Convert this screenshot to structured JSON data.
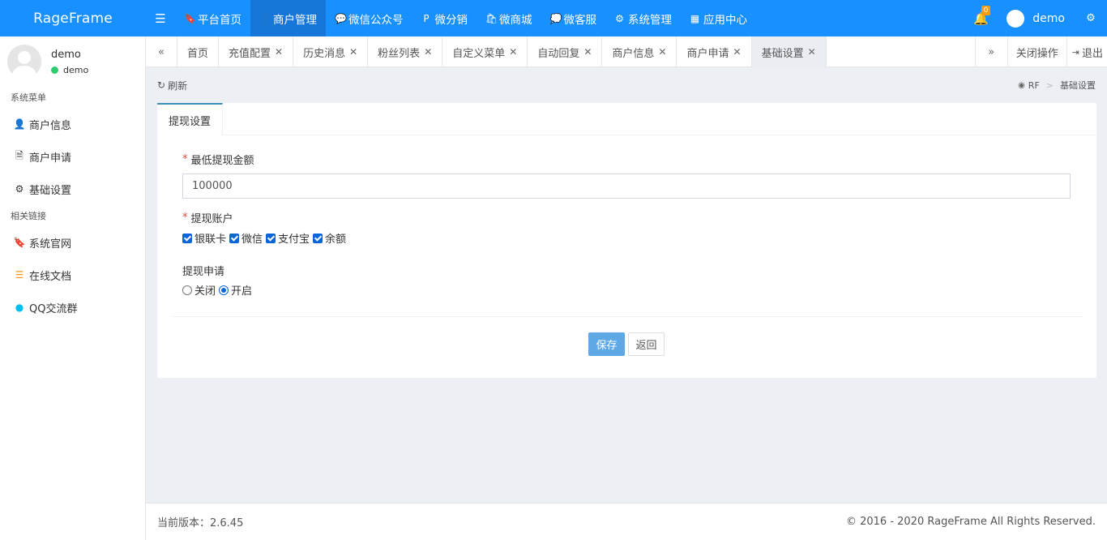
{
  "header": {
    "brand": "RageFrame",
    "nav": [
      {
        "label": "平台首页",
        "icon": "bookmark-icon",
        "glyph": "🔖",
        "active": false
      },
      {
        "label": "商户管理",
        "icon": "user-plus-icon",
        "glyph": "👤",
        "active": true
      },
      {
        "label": "微信公众号",
        "icon": "wechat-icon",
        "glyph": "💬",
        "active": false
      },
      {
        "label": "微分销",
        "icon": "product-hunt-icon",
        "glyph": "P",
        "active": false
      },
      {
        "label": "微商城",
        "icon": "shopping-bag-icon",
        "glyph": "🛍",
        "active": false
      },
      {
        "label": "微客服",
        "icon": "comments-icon",
        "glyph": "💭",
        "active": false
      },
      {
        "label": "系统管理",
        "icon": "cogs-icon",
        "glyph": "⚙",
        "active": false
      },
      {
        "label": "应用中心",
        "icon": "th-large-icon",
        "glyph": "▦",
        "active": false
      }
    ],
    "notification_count": "0",
    "username": "demo"
  },
  "sidebar": {
    "user_name": "demo",
    "user_status": "demo",
    "section1": "系统菜单",
    "items1": [
      {
        "label": "商户信息",
        "icon": "user-plus-icon",
        "glyph": "👤"
      },
      {
        "label": "商户申请",
        "icon": "file-text-icon",
        "glyph": "🗎"
      },
      {
        "label": "基础设置",
        "icon": "gear-icon",
        "glyph": "⚙"
      }
    ],
    "section2": "相关链接",
    "items2": [
      {
        "label": "系统官网",
        "icon": "bookmark-icon",
        "glyph": "🔖",
        "color": "#dd4b39"
      },
      {
        "label": "在线文档",
        "icon": "list-icon",
        "glyph": "☰",
        "color": "#f39c12"
      },
      {
        "label": "QQ交流群",
        "icon": "qq-icon",
        "glyph": "●",
        "color": "#00c0ef"
      }
    ]
  },
  "tabs": {
    "items": [
      {
        "label": "首页",
        "closable": false,
        "active": false
      },
      {
        "label": "充值配置",
        "closable": true,
        "active": false
      },
      {
        "label": "历史消息",
        "closable": true,
        "active": false
      },
      {
        "label": "粉丝列表",
        "closable": true,
        "active": false
      },
      {
        "label": "自定义菜单",
        "closable": true,
        "active": false
      },
      {
        "label": "自动回复",
        "closable": true,
        "active": false
      },
      {
        "label": "商户信息",
        "closable": true,
        "active": false
      },
      {
        "label": "商户申请",
        "closable": true,
        "active": false
      },
      {
        "label": "基础设置",
        "closable": true,
        "active": true
      }
    ],
    "close_ops": "关闭操作",
    "logout": "退出"
  },
  "content": {
    "refresh": "刷新",
    "breadcrumb_root": "RF",
    "breadcrumb_current": "基础设置",
    "box_tab": "提现设置",
    "min_amount_label": "最低提现金额",
    "min_amount_value": "100000",
    "accounts_label": "提现账户",
    "accounts": [
      {
        "label": "银联卡",
        "checked": true
      },
      {
        "label": "微信",
        "checked": true
      },
      {
        "label": "支付宝",
        "checked": true
      },
      {
        "label": "余额",
        "checked": true
      }
    ],
    "apply_label": "提现申请",
    "apply_options": [
      {
        "label": "关闭",
        "checked": false
      },
      {
        "label": "开启",
        "checked": true
      }
    ],
    "save": "保存",
    "back": "返回"
  },
  "footer": {
    "version": "当前版本：2.6.45",
    "copyright": "© 2016 - 2020 RageFrame All Rights Reserved."
  }
}
